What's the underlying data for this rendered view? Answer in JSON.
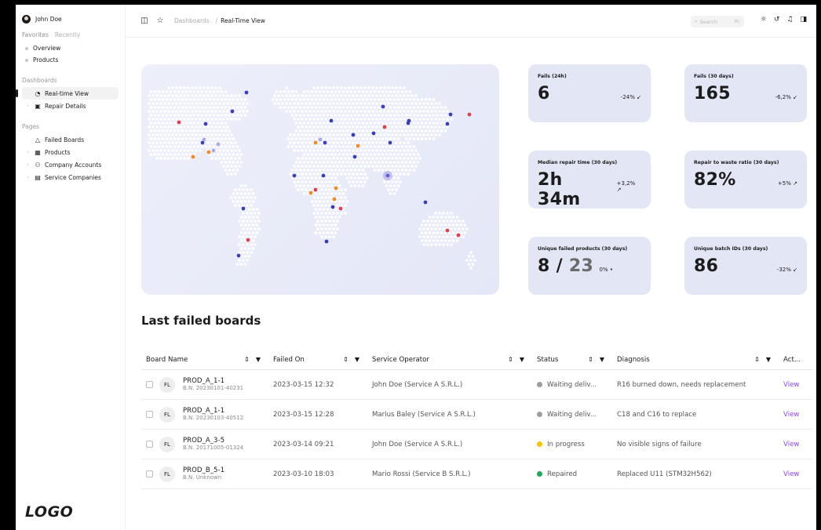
{
  "sidebar": {
    "user_name": "John Doe",
    "tabs": [
      "Favorites",
      "Recently"
    ],
    "favorites": [
      "Overview",
      "Products"
    ],
    "dashboards_label": "Dashboards",
    "dashboards": [
      {
        "label": "Real-time View",
        "icon": "pie-chart-icon",
        "active": true
      },
      {
        "label": "Repair Details",
        "icon": "id-card-icon",
        "active": false
      }
    ],
    "pages_label": "Pages",
    "pages": [
      {
        "label": "Failed Boards",
        "icon": "warning-triangle-icon"
      },
      {
        "label": "Products",
        "icon": "grid-icon"
      },
      {
        "label": "Company Accounts",
        "icon": "users-icon"
      },
      {
        "label": "Service Companies",
        "icon": "document-icon"
      }
    ],
    "logo": "LOGO"
  },
  "header": {
    "breadcrumb_root": "Dashboards",
    "separator": "/",
    "breadcrumb_current": "Real-Time View",
    "search_placeholder": "Search",
    "search_shortcut": "⌘/"
  },
  "stats": [
    {
      "label": "Fails (24h)",
      "value": "6",
      "delta": "-24%"
    },
    {
      "label": "Fails (30 days)",
      "value": "165",
      "delta": "-6,2%"
    },
    {
      "label": "Median repair time (30 days)",
      "value": "2h 34m",
      "delta": "+3,2%"
    },
    {
      "label": "Repair to waste ratio (30 days)",
      "value": "82%",
      "delta": "+5%"
    },
    {
      "label": "Unique failed products (30 days)",
      "value_main": "8 /",
      "value_sub": " 23",
      "delta": "0%"
    },
    {
      "label": "Unique batch IDs (30 days)",
      "value": "86",
      "delta": "-32%"
    }
  ],
  "colors": {
    "accent": "#8b45f0",
    "card": "#e3e6f5",
    "waiting": "#9e9e9e",
    "in_progress": "#f5c400",
    "repaired": "#1fa85b"
  },
  "table": {
    "title": "Last failed boards",
    "columns": [
      "Board Name",
      "Failed On",
      "Service Operator",
      "Status",
      "Diagnosis",
      "Act..."
    ],
    "rows": [
      {
        "initials": "FL",
        "name": "PROD_A_1-1",
        "bn": "B.N. 20230101-40231",
        "failed_on": "2023-03-15 12:32",
        "operator": "John Doe (Service A S.R.L.)",
        "status": "Waiting deliv...",
        "status_color": "#9e9e9e",
        "diagnosis": "R16 burned down, needs replacement",
        "action": "View"
      },
      {
        "initials": "FL",
        "name": "PROD_A_1-1",
        "bn": "B.N. 20230103-40512",
        "failed_on": "2023-03-15 12:28",
        "operator": "Marius Baley (Service A S.R.L.)",
        "status": "Waiting deliv...",
        "status_color": "#9e9e9e",
        "diagnosis": "C18 and C16 to replace",
        "action": "View"
      },
      {
        "initials": "FL",
        "name": "PROD_A_3-5",
        "bn": "B.N. 20171005-01324",
        "failed_on": "2023-03-14 09:21",
        "operator": "John Doe (Service A S.R.L.)",
        "status": "In progress",
        "status_color": "#f5c400",
        "diagnosis": "No visible signs of failure",
        "action": "View"
      },
      {
        "initials": "FL",
        "name": "PROD_B_5-1",
        "bn": "B.N. Unknown",
        "failed_on": "2023-03-10 18:03",
        "operator": "Mario Rossi (Service B S.R.L.)",
        "status": "Repaired",
        "status_color": "#1fa85b",
        "diagnosis": "Replaced U11 (STM32H562)",
        "action": "View"
      }
    ]
  }
}
